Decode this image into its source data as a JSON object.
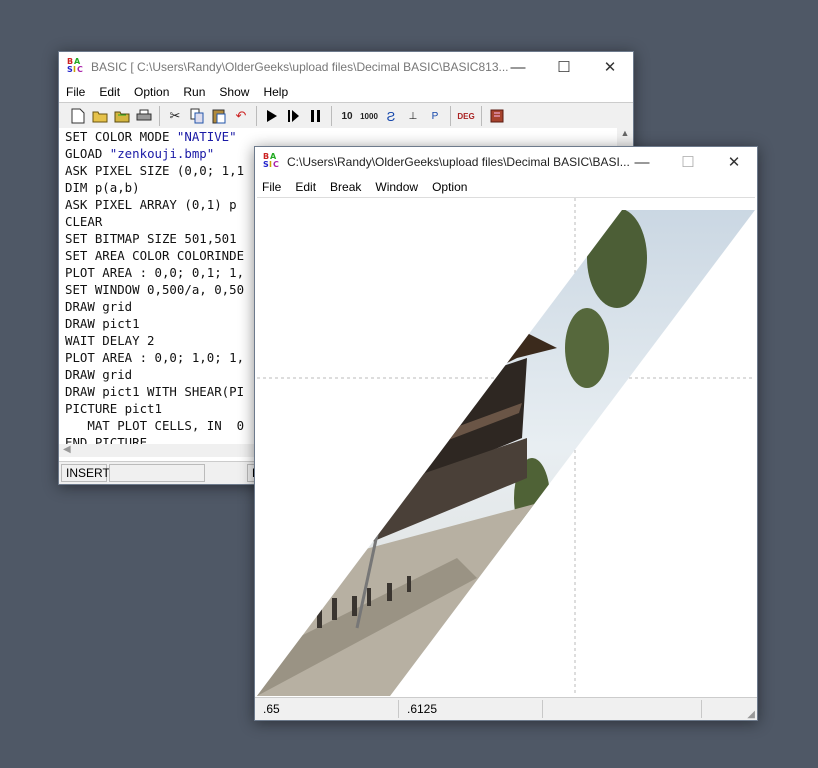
{
  "editor": {
    "title": "BASIC [ C:\\Users\\Randy\\OlderGeeks\\upload files\\Decimal BASIC\\BASIC813...",
    "menu": [
      "File",
      "Edit",
      "Option",
      "Run",
      "Show",
      "Help"
    ],
    "toolbar_icons": [
      "new-file-icon",
      "open-folder-icon",
      "open-file-icon",
      "print-icon",
      "cut-icon",
      "copy-icon",
      "paste-icon",
      "undo-icon",
      "run-icon",
      "step-icon",
      "pause-icon",
      "decimal-10-icon",
      "decimal-1000-icon",
      "complex-icon",
      "rational-icon",
      "plot-icon",
      "degree-icon",
      "help-book-icon"
    ],
    "toolbar_text": {
      "deg": "DEG"
    },
    "code_lines": [
      [
        "SET COLOR MODE ",
        "\"NATIVE\"",
        ""
      ],
      [
        "GLOAD ",
        "\"zenkouji.bmp\"",
        ""
      ],
      [
        "ASK PIXEL SIZE (0,0; 1,1",
        "",
        ""
      ],
      [
        "DIM p(a,b)",
        "",
        ""
      ],
      [
        "ASK PIXEL ARRAY (0,1) p",
        "",
        ""
      ],
      [
        "CLEAR",
        "",
        ""
      ],
      [
        "SET BITMAP SIZE 501,501",
        "",
        ""
      ],
      [
        "SET AREA COLOR COLORINDE",
        "",
        ""
      ],
      [
        "PLOT AREA : 0,0; 0,1; 1,",
        "",
        ""
      ],
      [
        "SET WINDOW 0,500/a, 0,50",
        "",
        ""
      ],
      [
        "DRAW grid",
        "",
        ""
      ],
      [
        "DRAW pict1",
        "",
        ""
      ],
      [
        "WAIT DELAY 2",
        "",
        ""
      ],
      [
        "PLOT AREA : 0,0; 1,0; 1,",
        "",
        ""
      ],
      [
        "DRAW grid",
        "",
        ""
      ],
      [
        "DRAW pict1 WITH SHEAR(PI",
        "",
        ""
      ],
      [
        "PICTURE pict1",
        "",
        ""
      ],
      [
        "   MAT PLOT CELLS, IN  0",
        "",
        ""
      ],
      [
        "END PICTURE",
        "",
        ""
      ]
    ],
    "status": {
      "mode": "INSERT",
      "cell2": "",
      "cell3": "F"
    }
  },
  "output": {
    "title": "C:\\Users\\Randy\\OlderGeeks\\upload files\\Decimal BASIC\\BASI...",
    "menu": [
      "File",
      "Edit",
      "Break",
      "Window",
      "Option"
    ],
    "status": {
      "x": ".65",
      "y": ".6125",
      "extra": ""
    },
    "image_description_colors": {
      "sky": "#dfe7ee",
      "roof": "#3b2a1c",
      "wall": "#2e2722",
      "ground": "#b7b0a2",
      "trees": "#4c5e36"
    }
  },
  "window_glyphs": {
    "minimize": "—",
    "maximize": "☐",
    "close": "✕"
  }
}
